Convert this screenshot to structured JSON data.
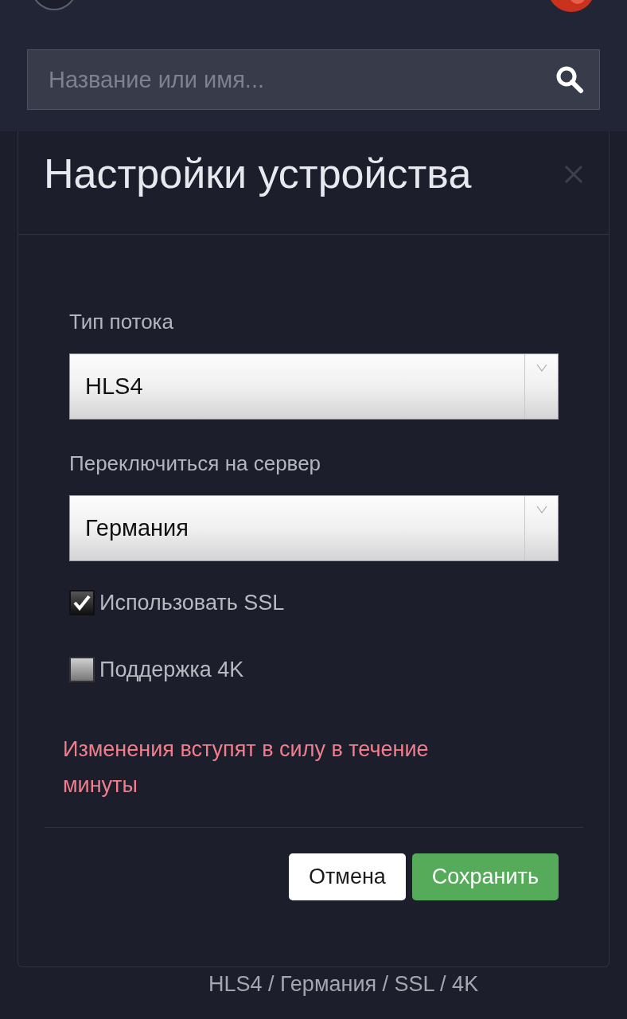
{
  "search": {
    "placeholder": "Название или имя..."
  },
  "dialog": {
    "title": "Настройки устройства",
    "fields": [
      {
        "label": "Тип потока",
        "value": "HLS4"
      },
      {
        "label": "Переключиться на сервер",
        "value": "Германия"
      }
    ],
    "checkboxes": [
      {
        "label": "Использовать SSL",
        "checked": true
      },
      {
        "label": "Поддержка 4K",
        "checked": false
      }
    ],
    "notice": "Изменения вступят в силу в течение минуты",
    "buttons": [
      {
        "label": "Отмена",
        "kind": "secondary"
      },
      {
        "label": "Сохранить",
        "kind": "primary"
      }
    ]
  },
  "background_summary": "HLS4 / Германия / SSL / 4K"
}
